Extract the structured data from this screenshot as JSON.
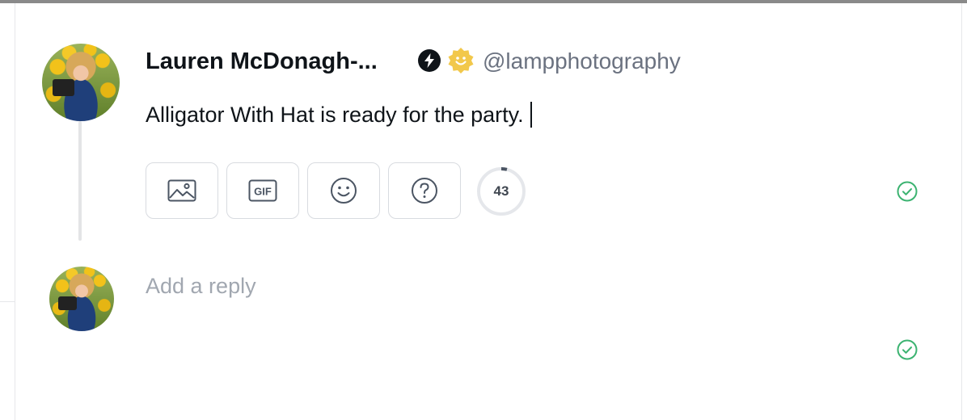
{
  "post": {
    "author_name": "Lauren McDonagh-...",
    "handle": "@lampphotography",
    "text": "Alligator With Hat is ready for the party.",
    "badges": [
      "bolt-icon",
      "verified-badge-icon"
    ]
  },
  "composer": {
    "tools": [
      {
        "icon": "image-icon"
      },
      {
        "icon": "gif-icon",
        "label": "GIF"
      },
      {
        "icon": "emoji-icon"
      },
      {
        "icon": "help-icon"
      }
    ],
    "char_count": "43",
    "char_progress": 0.04,
    "status_icon": "check-circle-icon"
  },
  "reply": {
    "placeholder": "Add a reply",
    "status_icon": "check-circle-icon"
  },
  "colors": {
    "accent_success": "#3cb371",
    "badge_gold": "#f2c84b",
    "text_primary": "#0f1419",
    "text_secondary": "#6b7280",
    "placeholder": "#a1a7b0",
    "border": "#d8dbe0"
  }
}
